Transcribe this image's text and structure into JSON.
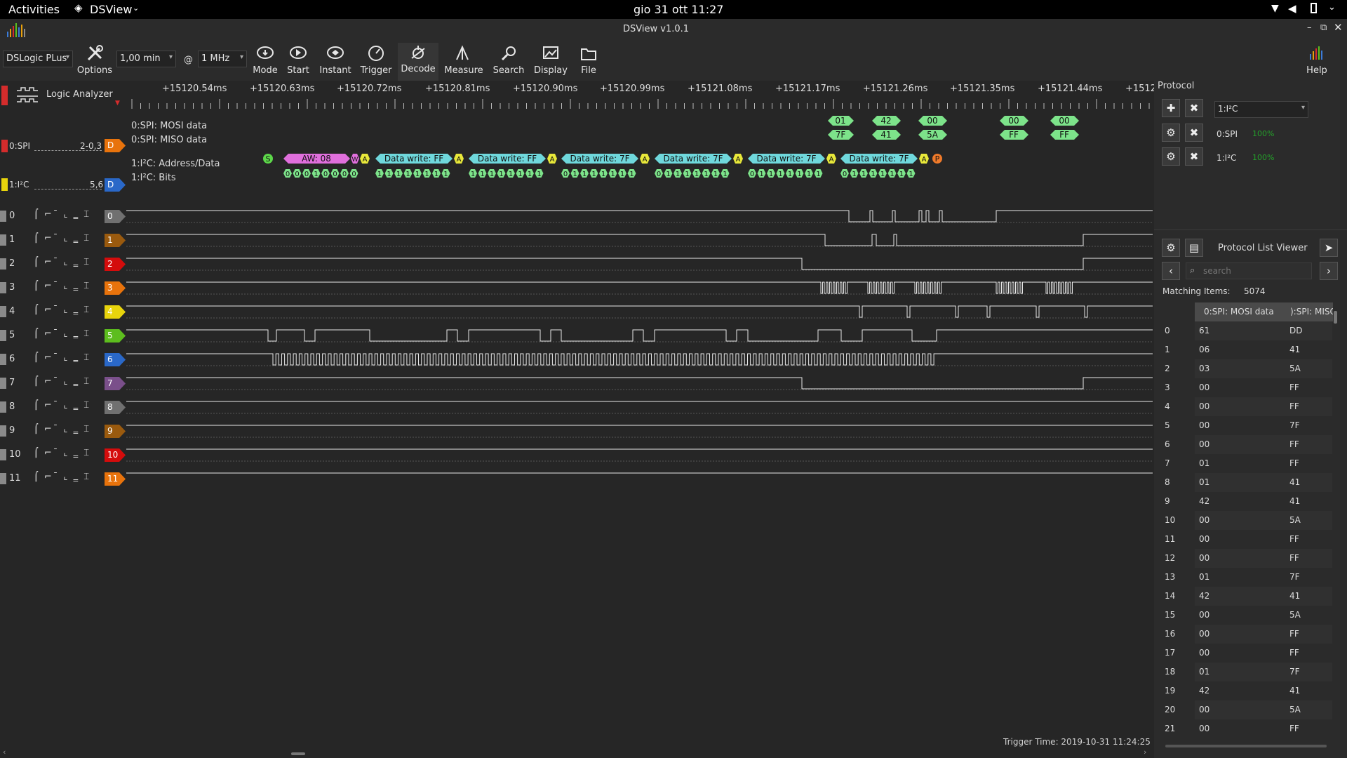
{
  "system": {
    "activities": "Activities",
    "app_menu": "DSView",
    "clock": "gio 31 ott  11:27"
  },
  "window": {
    "title": "DSView v1.0.1"
  },
  "toolbar": {
    "device": "DSLogic PLus",
    "duration": "1,00 min",
    "at": "@",
    "rate": "1 MHz",
    "options": "Options",
    "mode": "Mode",
    "start": "Start",
    "instant": "Instant",
    "trigger": "Trigger",
    "decode": "Decode",
    "measure": "Measure",
    "search": "Search",
    "display": "Display",
    "file": "File",
    "help": "Help"
  },
  "ruler": {
    "label": "Logic Analyzer",
    "ticks": [
      "+15120.54ms",
      "+15120.63ms",
      "+15120.72ms",
      "+15120.81ms",
      "+15120.90ms",
      "+15120.99ms",
      "+15121.08ms",
      "+15121.17ms",
      "+15121.26ms",
      "+15121.35ms",
      "+15121.44ms",
      "+1512"
    ]
  },
  "decoders": [
    {
      "name": "0:SPI",
      "channels": "2-0,3",
      "tag": "D",
      "tag_color": "#e8730c",
      "rows": [
        "0:SPI: MOSI data",
        "0:SPI: MISO data"
      ]
    },
    {
      "name": "1:I²C",
      "channels": "5,6",
      "tag": "D",
      "tag_color": "#2a68c8",
      "rows": [
        "1:I²C: Address/Data",
        "1:I²C: Bits"
      ]
    }
  ],
  "spi_annotations": [
    {
      "mosi": "01",
      "miso": "7F"
    },
    {
      "mosi": "42",
      "miso": "41"
    },
    {
      "mosi": "00",
      "miso": "5A"
    },
    {
      "mosi": "00",
      "miso": "FF"
    },
    {
      "mosi": "00",
      "miso": "FF"
    }
  ],
  "i2c_annotations": {
    "start": "S",
    "stop": "P",
    "address": "AW: 08",
    "ack": "A",
    "rw": "W",
    "writes": [
      "Data write: FF",
      "Data write: FF",
      "Data write: 7F",
      "Data write: 7F",
      "Data write: 7F",
      "Data write: 7F"
    ],
    "bits": [
      "00010000",
      "11111111",
      "11111111",
      "01111111",
      "01111111",
      "01111111",
      "01111111"
    ]
  },
  "channels": [
    {
      "num": "0",
      "color": "#707070"
    },
    {
      "num": "1",
      "color": "#9a5a0e"
    },
    {
      "num": "2",
      "color": "#d40c0c"
    },
    {
      "num": "3",
      "color": "#e8730c"
    },
    {
      "num": "4",
      "color": "#e8d40c"
    },
    {
      "num": "5",
      "color": "#5dbd1e"
    },
    {
      "num": "6",
      "color": "#2a68c8"
    },
    {
      "num": "7",
      "color": "#7a4f8a"
    },
    {
      "num": "8",
      "color": "#707070"
    },
    {
      "num": "9",
      "color": "#9a5a0e"
    },
    {
      "num": "10",
      "color": "#d40c0c"
    },
    {
      "num": "11",
      "color": "#e8730c"
    }
  ],
  "protocol_panel": {
    "title": "Protocol",
    "selected": "1:I²C",
    "entries": [
      {
        "name": "0:SPI",
        "progress": "100%"
      },
      {
        "name": "1:I²C",
        "progress": "100%"
      }
    ],
    "list_title": "Protocol List Viewer",
    "search_placeholder": "search",
    "matching_label": "Matching Items:",
    "matching_count": "5074",
    "col_mosi": "0:SPI: MOSI data",
    "col_miso": "):SPI: MISO",
    "rows": [
      {
        "i": "0",
        "mosi": "61",
        "miso": "DD"
      },
      {
        "i": "1",
        "mosi": "06",
        "miso": "41"
      },
      {
        "i": "2",
        "mosi": "03",
        "miso": "5A"
      },
      {
        "i": "3",
        "mosi": "00",
        "miso": "FF"
      },
      {
        "i": "4",
        "mosi": "00",
        "miso": "FF"
      },
      {
        "i": "5",
        "mosi": "00",
        "miso": "7F"
      },
      {
        "i": "6",
        "mosi": "00",
        "miso": "FF"
      },
      {
        "i": "7",
        "mosi": "01",
        "miso": "FF"
      },
      {
        "i": "8",
        "mosi": "01",
        "miso": "41"
      },
      {
        "i": "9",
        "mosi": "42",
        "miso": "41"
      },
      {
        "i": "10",
        "mosi": "00",
        "miso": "5A"
      },
      {
        "i": "11",
        "mosi": "00",
        "miso": "FF"
      },
      {
        "i": "12",
        "mosi": "00",
        "miso": "FF"
      },
      {
        "i": "13",
        "mosi": "01",
        "miso": "7F"
      },
      {
        "i": "14",
        "mosi": "42",
        "miso": "41"
      },
      {
        "i": "15",
        "mosi": "00",
        "miso": "5A"
      },
      {
        "i": "16",
        "mosi": "00",
        "miso": "FF"
      },
      {
        "i": "17",
        "mosi": "00",
        "miso": "FF"
      },
      {
        "i": "18",
        "mosi": "01",
        "miso": "7F"
      },
      {
        "i": "19",
        "mosi": "42",
        "miso": "41"
      },
      {
        "i": "20",
        "mosi": "00",
        "miso": "5A"
      },
      {
        "i": "21",
        "mosi": "00",
        "miso": "FF"
      }
    ]
  },
  "status": {
    "trigger_time": "Trigger Time: 2019-10-31 11:24:25"
  }
}
